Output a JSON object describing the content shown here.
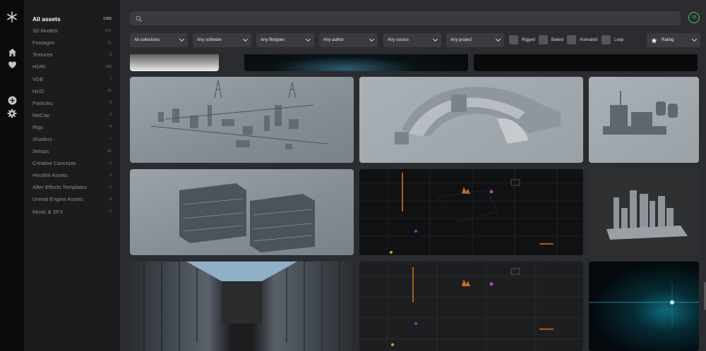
{
  "rail": {
    "icons": [
      "logo-icon",
      "home-icon",
      "heart-icon",
      "add-icon",
      "settings-icon"
    ]
  },
  "sidebar": {
    "items": [
      {
        "label": "All assets",
        "count": "1355"
      },
      {
        "label": "3D Models",
        "count": "421"
      },
      {
        "label": "Footages",
        "count": "11"
      },
      {
        "label": "Textures",
        "count": "3"
      },
      {
        "label": "HDRI",
        "count": "788"
      },
      {
        "label": "VDB",
        "count": "1"
      },
      {
        "label": "HUD",
        "count": "16"
      },
      {
        "label": "Particles",
        "count": "0"
      },
      {
        "label": "MoCap",
        "count": "0"
      },
      {
        "label": "Rigs",
        "count": "4"
      },
      {
        "label": "Shaders",
        "count": "1"
      },
      {
        "label": "Setups",
        "count": "82"
      },
      {
        "label": "Creative Concepts",
        "count": "2"
      },
      {
        "label": "Houdini Assets",
        "count": "2"
      },
      {
        "label": "After Effects Templates",
        "count": "0"
      },
      {
        "label": "Unreal Engine Assets",
        "count": "0"
      },
      {
        "label": "Music & SFX",
        "count": "0"
      }
    ]
  },
  "search": {
    "placeholder": "",
    "value": ""
  },
  "badge": {
    "value": "15",
    "color": "#3ecf5a"
  },
  "filters": {
    "collections": "All collections",
    "software": "Any software",
    "filetypes": "Any filetypes",
    "author": "Any author",
    "source": "Any source",
    "project": "Any project"
  },
  "toggles": {
    "rigged": "Rigged",
    "baked": "Baked",
    "animated": "Animated",
    "loop": "Loop"
  },
  "sort": {
    "label": "Rating"
  }
}
